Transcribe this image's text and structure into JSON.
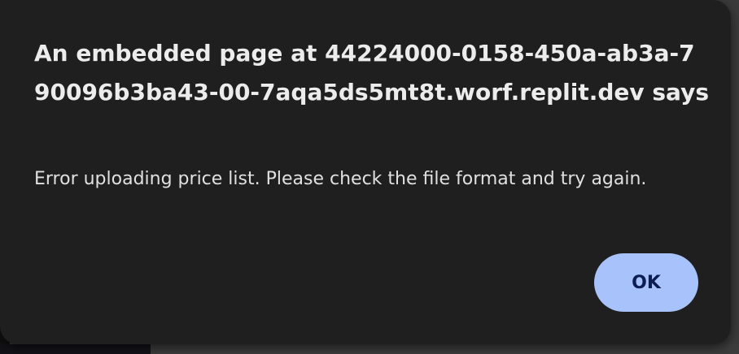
{
  "dialog": {
    "title": "An embedded page at 44224000-0158-450a-ab3a-790096b3ba43-00-7aqa5ds5mt8t.worf.replit.dev says",
    "message": "Error uploading price list. Please check the file format and try again.",
    "ok_label": "OK"
  },
  "colors": {
    "dialog_background": "#1f1f1f",
    "button_background": "#a8c3fc",
    "button_text": "#0b1d52",
    "text": "#ececec"
  }
}
